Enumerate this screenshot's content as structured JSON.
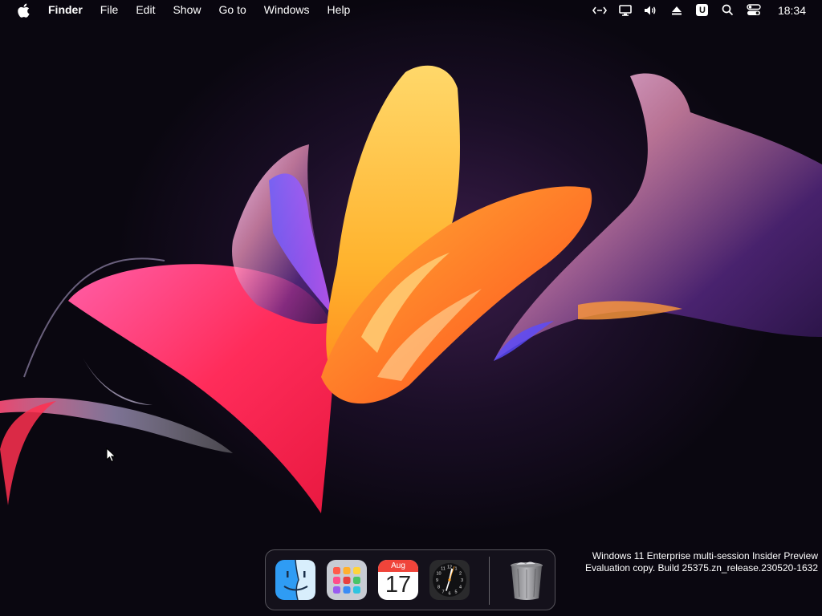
{
  "menubar": {
    "app_name": "Finder",
    "items": [
      "File",
      "Edit",
      "Show",
      "Go to",
      "Windows",
      "Help"
    ],
    "tray": {
      "icons": [
        "remote-desktop-icon",
        "display-icon",
        "volume-icon",
        "eject-icon",
        "u-app-icon",
        "search-icon",
        "control-center-icon"
      ],
      "u_label": "U",
      "time": "18:34"
    }
  },
  "dock": {
    "items": [
      {
        "name": "Finder",
        "icon": "finder-icon"
      },
      {
        "name": "Launchpad",
        "icon": "launchpad-icon"
      },
      {
        "name": "Calendar",
        "icon": "calendar-icon",
        "month": "Aug",
        "day": "17"
      },
      {
        "name": "Clock",
        "icon": "clock-icon"
      },
      {
        "name": "Trash",
        "icon": "trash-icon"
      }
    ]
  },
  "watermark": {
    "line1": "Windows 11 Enterprise multi-session Insider Preview",
    "line2": "Evaluation copy. Build 25375.zn_release.230520-1632"
  },
  "colors": {
    "accent_pink": "#ff3c7a",
    "accent_orange": "#ff7a1a",
    "accent_yellow": "#ffc23a",
    "calendar_red": "#f0443a",
    "background": "#0b0812"
  }
}
